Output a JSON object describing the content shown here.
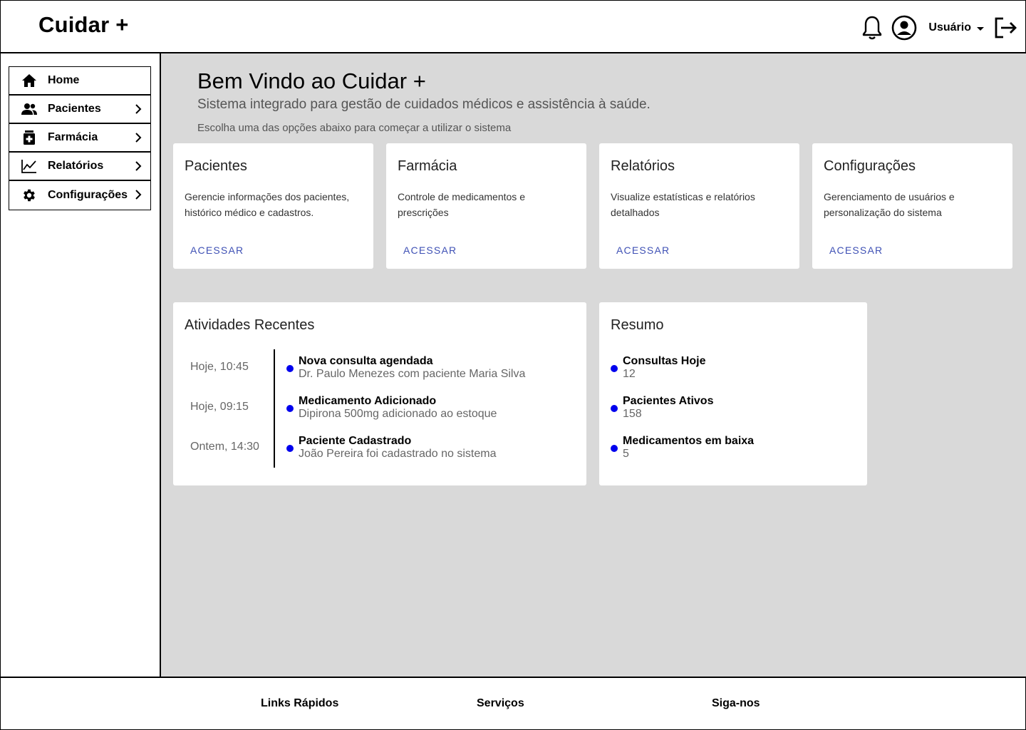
{
  "header": {
    "brand": "Cuidar +",
    "user_label": "Usuário",
    "icons": [
      "bell-icon",
      "account-circle-icon",
      "logout-icon"
    ]
  },
  "sidebar": {
    "items": [
      {
        "label": "Home",
        "icon": "home-icon",
        "has_chevron": false
      },
      {
        "label": "Pacientes",
        "icon": "people-icon",
        "has_chevron": true
      },
      {
        "label": "Farmácia",
        "icon": "pharmacy-icon",
        "has_chevron": true
      },
      {
        "label": "Relatórios",
        "icon": "chart-line-icon",
        "has_chevron": true
      },
      {
        "label": "Configurações",
        "icon": "gear-icon",
        "has_chevron": true
      }
    ]
  },
  "welcome": {
    "title": "Bem Vindo ao Cuidar +",
    "subtitle": "Sistema integrado para gestão de cuidados médicos e assistência à saúde.",
    "hint": "Escolha uma das opções abaixo para começar a utilizar o sistema"
  },
  "cards": [
    {
      "title": "Pacientes",
      "description": "Gerencie informações dos pacientes, histórico médico e cadastros.",
      "link": "ACESSAR"
    },
    {
      "title": "Farmácia",
      "description": "Controle de medicamentos e prescrições",
      "link": "ACESSAR"
    },
    {
      "title": "Relatórios",
      "description": "Visualize estatísticas e relatórios detalhados",
      "link": "ACESSAR"
    },
    {
      "title": "Configurações",
      "description": "Gerenciamento de usuários e personalização do sistema",
      "link": "ACESSAR"
    }
  ],
  "activities": {
    "title": "Atividades Recentes",
    "items": [
      {
        "time": "Hoje, 10:45",
        "title": "Nova consulta agendada",
        "detail": "Dr. Paulo Menezes com paciente Maria Silva"
      },
      {
        "time": "Hoje, 09:15",
        "title": "Medicamento Adicionado",
        "detail": "Dipirona 500mg adicionado ao estoque"
      },
      {
        "time": "Ontem, 14:30",
        "title": "Paciente Cadastrado",
        "detail": "João Pereira foi cadastrado no sistema"
      }
    ]
  },
  "summary": {
    "title": "Resumo",
    "items": [
      {
        "label": "Consultas Hoje",
        "value": "12"
      },
      {
        "label": "Pacientes Ativos",
        "value": "158"
      },
      {
        "label": "Medicamentos em baixa",
        "value": "5"
      }
    ]
  },
  "footer": {
    "links": [
      "Links Rápidos",
      "Serviços",
      "Siga-nos"
    ]
  },
  "colors": {
    "accent": "#3f51b5",
    "dot": "#0000ee",
    "main_bg": "#d9d9d9"
  }
}
